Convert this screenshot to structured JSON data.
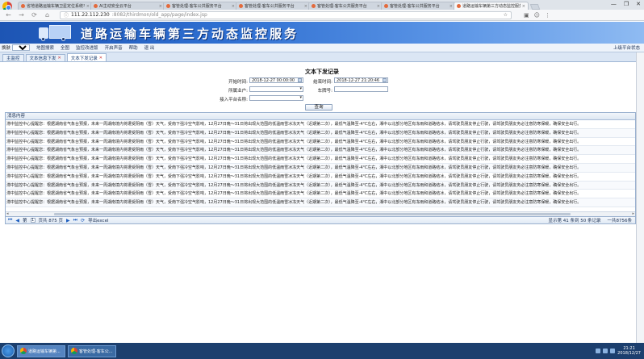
{
  "browser": {
    "tabs": [
      {
        "label": "省地道路运输车辆卫星定位系统平台"
      },
      {
        "label": "AI主动安全云平台"
      },
      {
        "label": "客管处理-客车公共服务平台"
      },
      {
        "label": "客管处理-客车公共服务平台"
      },
      {
        "label": "客管处理-客车公共服务平台"
      },
      {
        "label": "客管处理-客车公共服务平台"
      },
      {
        "label": "道路运输车辆第三方动态监控服务"
      }
    ],
    "address_host": "111.22.112.230",
    "address_path": ":8082/thirdmon/old_app/page/index.jsp",
    "window_controls": [
      "—",
      "❐",
      "✕"
    ]
  },
  "banner": {
    "title": "道路运输车辆第三方动态监控服务"
  },
  "menubar": {
    "skin_label": "换肤",
    "skin_value": "蓝色",
    "items": [
      "地图搜索",
      "全图",
      "监控改进版",
      "开启声音",
      "帮助",
      "退 出"
    ],
    "location_status": "上级平台状态"
  },
  "app_tabs": [
    {
      "label": "主监控"
    },
    {
      "label": "文本信息下发"
    },
    {
      "label": "文本下发记录"
    }
  ],
  "form": {
    "title": "文本下发记录",
    "start_label": "开始时间:",
    "start_value": "2018-12-27 00:00:00",
    "end_label": "结束时间:",
    "end_value": "2018-12-27 21:20:46",
    "owner_label": "所属业户:",
    "owner_value": "",
    "plate_label": "车牌号:",
    "plate_value": "",
    "platform_label": "接入平台名称:",
    "platform_value": "",
    "query_button": "查询"
  },
  "grid": {
    "column": "消息内容",
    "row_text": "滞中监控中心提醒您：根据湖南省气象台预报，未来一周湖南境内将遭受阴雨（雪）天气，受南下强冷空气影响，12月27日晚～31日将出现大范围的低温雨雪冰冻天气（近期第二次），最低气温降至-4℃左右，湘中以北部分地区有冻雨和道路结冰，请驾驶员朋友停止行驶，请驾驶员朋友务必注意防寒保暖，确保安全出行。",
    "rows": 10
  },
  "pager": {
    "page_prefix": "第",
    "page_value": "1",
    "page_suffix": "页共 875 页",
    "export_label": "导出excel",
    "display_info": "显示第 41 条到 50 条记录",
    "total_info": "一共8756条"
  },
  "taskbar": {
    "tasks": [
      "道路运输车辆第...",
      "客管处理-客车公..."
    ],
    "time": "21:21",
    "date": "2018/12/27"
  }
}
